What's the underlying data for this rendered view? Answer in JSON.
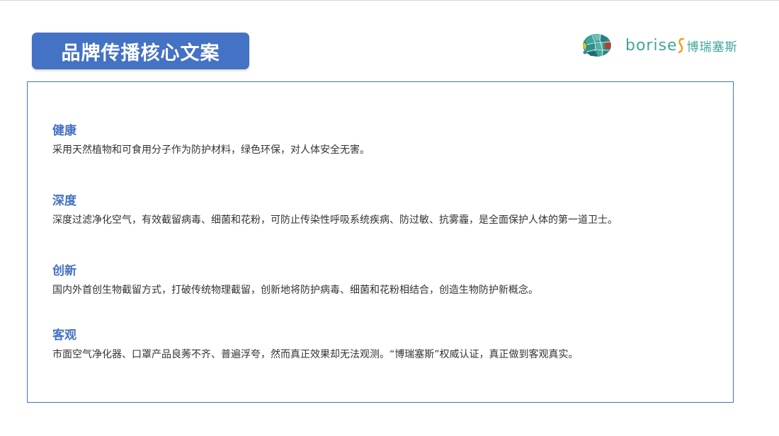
{
  "header": {
    "title": "品牌传播核心文案"
  },
  "logo": {
    "wordmark": "borises",
    "wordmark_main": "borise",
    "chinese_name": "博瑞塞斯",
    "brand_color": "#3fa69b"
  },
  "colors": {
    "accent": "#4472c4",
    "body_text": "#333333"
  },
  "sections": [
    {
      "heading": "健康",
      "text": "采用天然植物和可食用分子作为防护材料，绿色环保，对人体安全无害。"
    },
    {
      "heading": "深度",
      "text": "深度过滤净化空气，有效截留病毒、细菌和花粉，可防止传染性呼吸系统疾病、防过敏、抗雾霾，是全面保护人体的第一道卫士。"
    },
    {
      "heading": "创新",
      "text": "国内外首创生物截留方式，打破传统物理截留，创新地将防护病毒、细菌和花粉相结合，创造生物防护新概念。"
    },
    {
      "heading": "客观",
      "text": "市面空气净化器、口罩产品良莠不齐、普遍浮夸，然而真正效果却无法观测。“博瑞塞斯”权威认证，真正做到客观真实。"
    }
  ]
}
